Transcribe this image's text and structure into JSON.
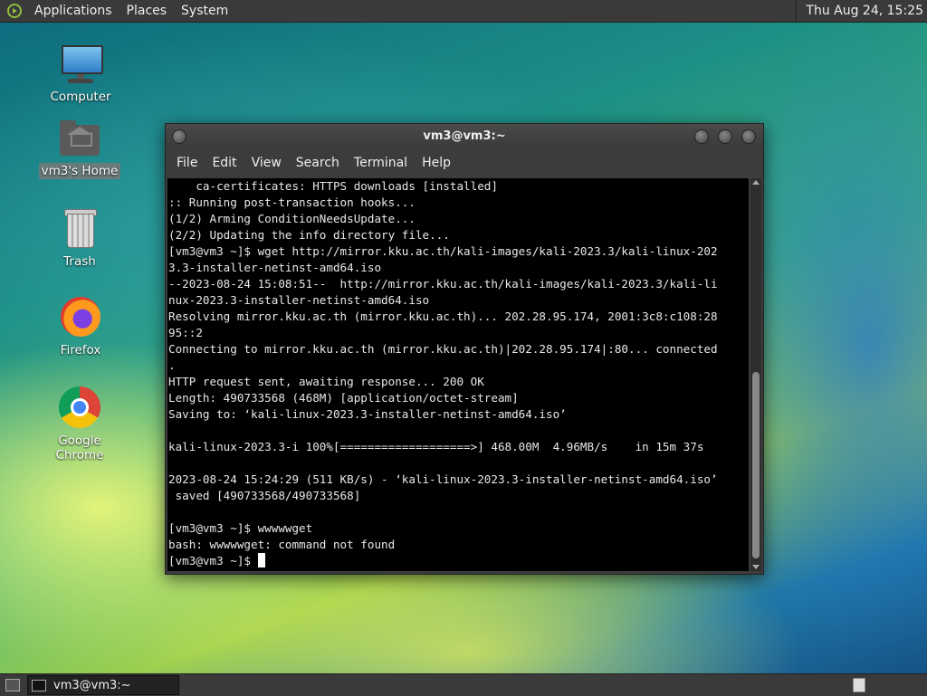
{
  "top_panel": {
    "menus": [
      "Applications",
      "Places",
      "System"
    ],
    "clock": "Thu Aug 24, 15:25"
  },
  "desktop": {
    "icons": [
      {
        "label": "Computer",
        "icon": "computer-icon"
      },
      {
        "label": "vm3's Home",
        "icon": "home-folder-icon"
      },
      {
        "label": "Trash",
        "icon": "trash-icon"
      },
      {
        "label": "Firefox",
        "icon": "firefox-icon"
      },
      {
        "label": "Google Chrome",
        "icon": "chrome-icon"
      }
    ]
  },
  "terminal": {
    "title": "vm3@vm3:~",
    "menu": [
      "File",
      "Edit",
      "View",
      "Search",
      "Terminal",
      "Help"
    ],
    "lines": [
      "    ca-certificates: HTTPS downloads [installed]",
      ":: Running post-transaction hooks...",
      "(1/2) Arming ConditionNeedsUpdate...",
      "(2/2) Updating the info directory file...",
      "[vm3@vm3 ~]$ wget http://mirror.kku.ac.th/kali-images/kali-2023.3/kali-linux-202",
      "3.3-installer-netinst-amd64.iso",
      "--2023-08-24 15:08:51--  http://mirror.kku.ac.th/kali-images/kali-2023.3/kali-li",
      "nux-2023.3-installer-netinst-amd64.iso",
      "Resolving mirror.kku.ac.th (mirror.kku.ac.th)... 202.28.95.174, 2001:3c8:c108:28",
      "95::2",
      "Connecting to mirror.kku.ac.th (mirror.kku.ac.th)|202.28.95.174|:80... connected",
      ".",
      "HTTP request sent, awaiting response... 200 OK",
      "Length: 490733568 (468M) [application/octet-stream]",
      "Saving to: ‘kali-linux-2023.3-installer-netinst-amd64.iso’",
      "",
      "kali-linux-2023.3-i 100%[===================>] 468.00M  4.96MB/s    in 15m 37s",
      "",
      "2023-08-24 15:24:29 (511 KB/s) - ‘kali-linux-2023.3-installer-netinst-amd64.iso’",
      " saved [490733568/490733568]",
      "",
      "[vm3@vm3 ~]$ wwwwwget",
      "bash: wwwwwget: command not found"
    ],
    "prompt": "[vm3@vm3 ~]$ "
  },
  "bottom_panel": {
    "task_label": "vm3@vm3:~"
  }
}
